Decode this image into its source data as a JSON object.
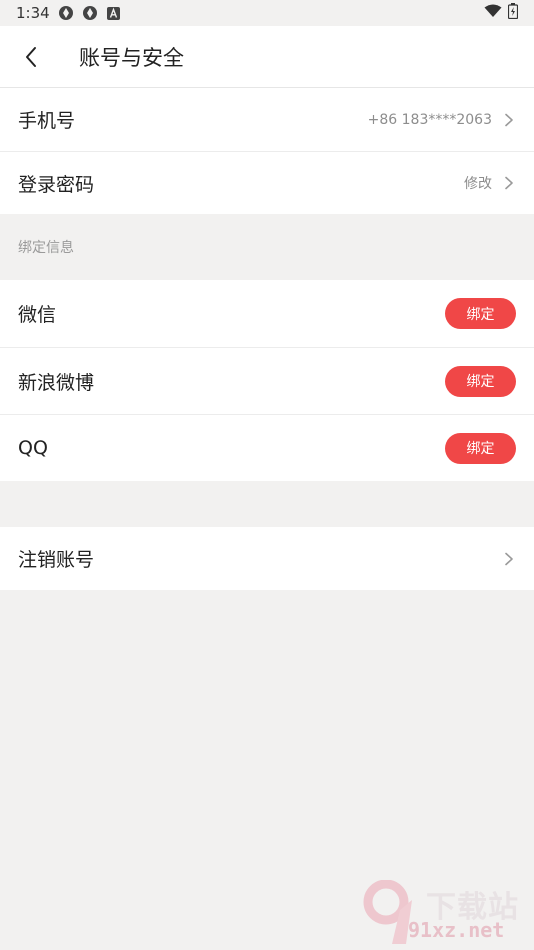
{
  "status_bar": {
    "time": "1:34",
    "icons": [
      "app-notification-icon",
      "app-notification-icon",
      "a-badge-icon",
      "wifi-icon",
      "battery-icon"
    ]
  },
  "header": {
    "title": "账号与安全"
  },
  "account": {
    "phone": {
      "label": "手机号",
      "value": "+86 183****2063"
    },
    "password": {
      "label": "登录密码",
      "value": "修改"
    }
  },
  "bind_section": {
    "title": "绑定信息",
    "items": [
      {
        "label": "微信",
        "button": "绑定"
      },
      {
        "label": "新浪微博",
        "button": "绑定"
      },
      {
        "label": "QQ",
        "button": "绑定"
      }
    ]
  },
  "cancel_account": {
    "label": "注销账号"
  },
  "watermark": {
    "line1": "下载站",
    "line2": "91xz.net"
  },
  "colors": {
    "accent": "#f04747",
    "background": "#f2f1f0"
  }
}
